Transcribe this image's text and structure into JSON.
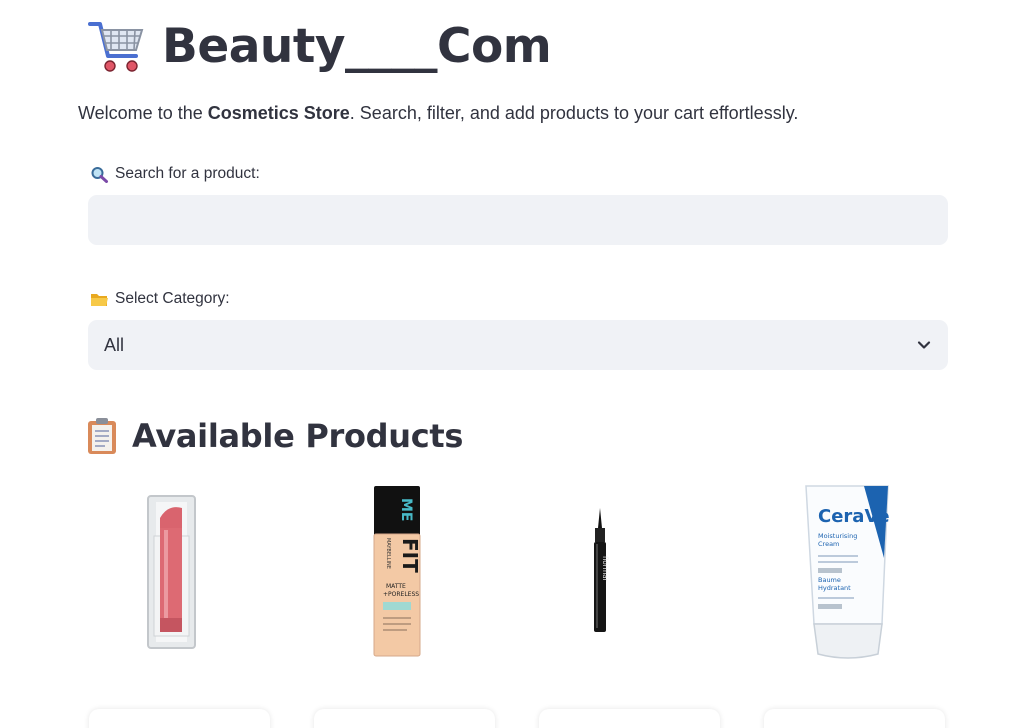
{
  "app": {
    "title": "Beauty____Com",
    "welcome_prefix": "Welcome to the ",
    "welcome_bold": "Cosmetics Store",
    "welcome_suffix": ". Search, filter, and add products to your cart effortlessly."
  },
  "search": {
    "label": "Search for a product:",
    "value": "",
    "placeholder": ""
  },
  "category": {
    "label": "Select Category:",
    "selected": "All"
  },
  "products_section": {
    "title": "Available Products"
  },
  "products": [
    {
      "icon": "lipstick-image"
    },
    {
      "icon": "foundation-bottle-image",
      "brand": "MAYBELLINE",
      "name": "FIT ME",
      "subtitle": "MATTE + PORELESS"
    },
    {
      "icon": "eyeliner-pen-image",
      "brand": "flormar"
    },
    {
      "icon": "moisturising-cream-image",
      "brand": "CeraVe",
      "name": "Moisturising Cream",
      "name_fr": "Baume Hydratant"
    }
  ]
}
